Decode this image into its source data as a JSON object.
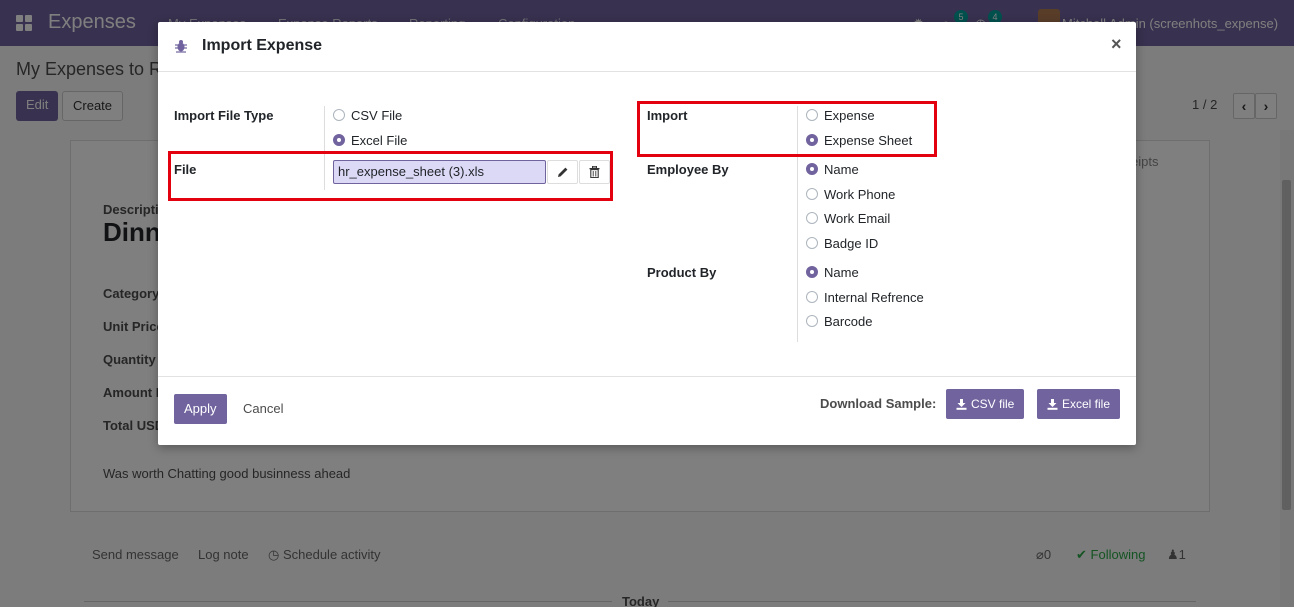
{
  "navbar": {
    "app_title": "Expenses",
    "menu": [
      "My Expenses",
      "Expense Reports",
      "Reporting",
      "Configuration"
    ],
    "messages_count": "5",
    "activities_count": "4",
    "user": "Mitchell Admin (screenhots_expense)"
  },
  "control_panel": {
    "breadcrumb": "My Expenses to R",
    "edit_label": "Edit",
    "create_label": "Create",
    "pager": "1 / 2",
    "prev_icon": "chevron-left-icon",
    "next_icon": "chevron-right-icon"
  },
  "sheet": {
    "tab_receipts": "eipts",
    "description_label": "Descripti",
    "description_value": "Dinn",
    "fields": [
      "Category",
      "Unit Price",
      "Quantity",
      "Amount I",
      "Total USD"
    ],
    "note": "Was worth Chatting good businness ahead"
  },
  "chatter": {
    "send_message": "Send message",
    "log_note": "Log note",
    "schedule_activity": "Schedule activity",
    "attachments": "0",
    "following": "Following",
    "followers": "1",
    "today": "Today"
  },
  "modal": {
    "title": "Import Expense",
    "close_symbol": "×",
    "import_file_type": {
      "label": "Import File Type",
      "options": [
        "CSV File",
        "Excel File"
      ],
      "selected": "Excel File"
    },
    "file": {
      "label": "File",
      "value": "hr_expense_sheet (3).xls",
      "edit_icon": "pencil-icon",
      "delete_icon": "trash-icon"
    },
    "import": {
      "label": "Import",
      "options": [
        "Expense",
        "Expense Sheet"
      ],
      "selected": "Expense Sheet"
    },
    "employee_by": {
      "label": "Employee By",
      "options": [
        "Name",
        "Work Phone",
        "Work Email",
        "Badge ID"
      ],
      "selected": "Name"
    },
    "product_by": {
      "label": "Product By",
      "options": [
        "Name",
        "Internal Refrence",
        "Barcode"
      ],
      "selected": "Name"
    },
    "footer": {
      "apply_label": "Apply",
      "cancel_label": "Cancel",
      "download_label": "Download Sample:",
      "csv_button": "CSV file",
      "excel_button": "Excel file"
    }
  },
  "colors": {
    "brand": "#71639e",
    "highlight": "#e3000f",
    "file_input_bg": "#dcd9f7"
  }
}
